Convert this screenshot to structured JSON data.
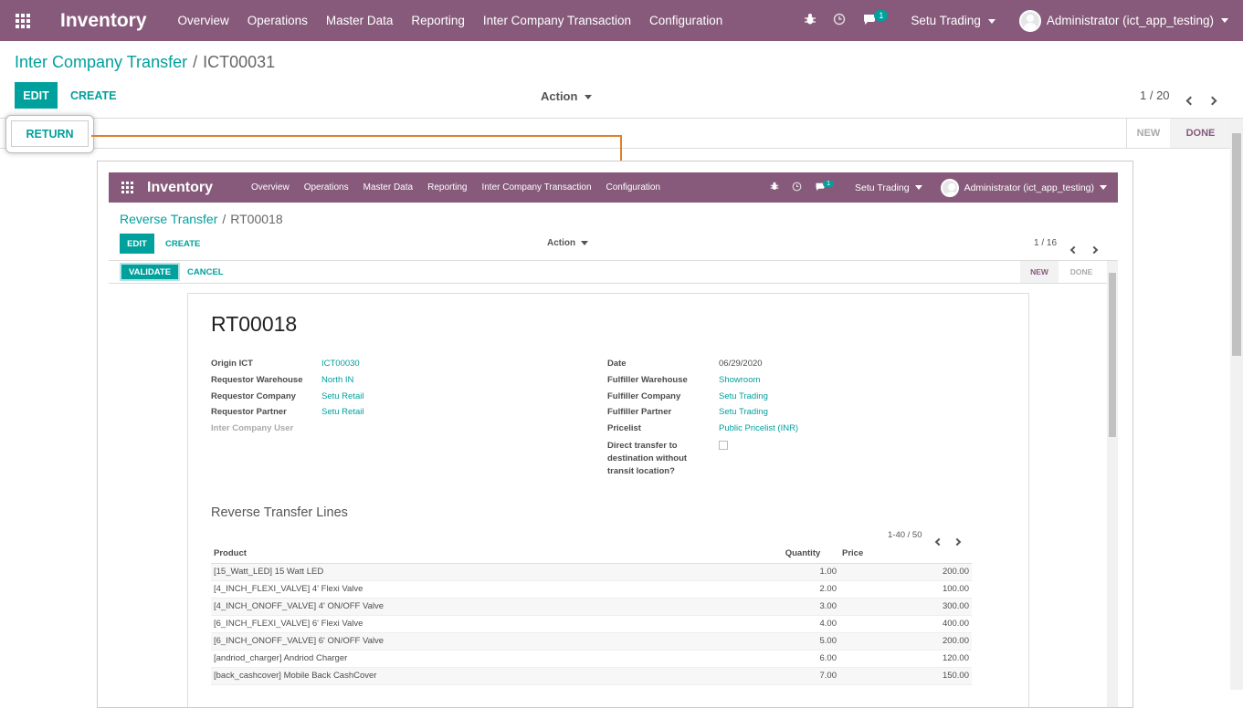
{
  "outer": {
    "brand": "Inventory",
    "menu": [
      "Overview",
      "Operations",
      "Master Data",
      "Reporting",
      "Inter Company Transaction",
      "Configuration"
    ],
    "notification_count": "1",
    "company": "Setu Trading",
    "user": "Administrator (ict_app_testing)",
    "breadcrumb": {
      "parent": "Inter Company Transfer",
      "current": "ICT00031"
    },
    "edit_label": "EDIT",
    "create_label": "CREATE",
    "action_label": "Action",
    "pager": "1 / 20",
    "return_label": "RETURN",
    "status": [
      "NEW",
      "DONE"
    ]
  },
  "inner": {
    "brand": "Inventory",
    "menu": [
      "Overview",
      "Operations",
      "Master Data",
      "Reporting",
      "Inter Company Transaction",
      "Configuration"
    ],
    "notification_count": "1",
    "company": "Setu Trading",
    "user": "Administrator (ict_app_testing)",
    "breadcrumb": {
      "parent": "Reverse Transfer",
      "current": "RT00018"
    },
    "edit_label": "EDIT",
    "create_label": "CREATE",
    "action_label": "Action",
    "pager": "1 / 16",
    "validate_label": "VALIDATE",
    "cancel_label": "CANCEL",
    "status": [
      "NEW",
      "DONE"
    ],
    "record_title": "RT00018",
    "fields_left": [
      {
        "label": "Origin ICT",
        "value": "ICT00030"
      },
      {
        "label": "Requestor Warehouse",
        "value": "North IN"
      },
      {
        "label": "Requestor Company",
        "value": "Setu Retail"
      },
      {
        "label": "Requestor Partner",
        "value": "Setu Retail"
      },
      {
        "label": "Inter Company User",
        "value": ""
      }
    ],
    "fields_right": [
      {
        "label": "Date",
        "value": "06/29/2020"
      },
      {
        "label": "Fulfiller Warehouse",
        "value": "Showroom"
      },
      {
        "label": "Fulfiller Company",
        "value": "Setu Trading"
      },
      {
        "label": "Fulfiller Partner",
        "value": "Setu Trading"
      },
      {
        "label": "Pricelist",
        "value": "Public Pricelist (INR)"
      }
    ],
    "direct_transfer_label": [
      "Direct transfer to",
      "destination without",
      "transit location?"
    ],
    "lines_title": "Reverse Transfer Lines",
    "lines_pager": "1-40 / 50",
    "columns": [
      "Product",
      "Quantity",
      "Price"
    ],
    "rows": [
      [
        "[15_Watt_LED] 15 Watt LED",
        "1.00",
        "200.00"
      ],
      [
        "[4_INCH_FLEXI_VALVE] 4' Flexi Valve",
        "2.00",
        "100.00"
      ],
      [
        "[4_INCH_ONOFF_VALVE] 4' ON/OFF Valve",
        "3.00",
        "300.00"
      ],
      [
        "[6_INCH_FLEXI_VALVE] 6' Flexi Valve",
        "4.00",
        "400.00"
      ],
      [
        "[6_INCH_ONOFF_VALVE] 6' ON/OFF Valve",
        "5.00",
        "200.00"
      ],
      [
        "[andriod_charger] Andriod Charger",
        "6.00",
        "120.00"
      ],
      [
        "[back_cashcover] Mobile Back CashCover",
        "7.00",
        "150.00"
      ]
    ]
  }
}
